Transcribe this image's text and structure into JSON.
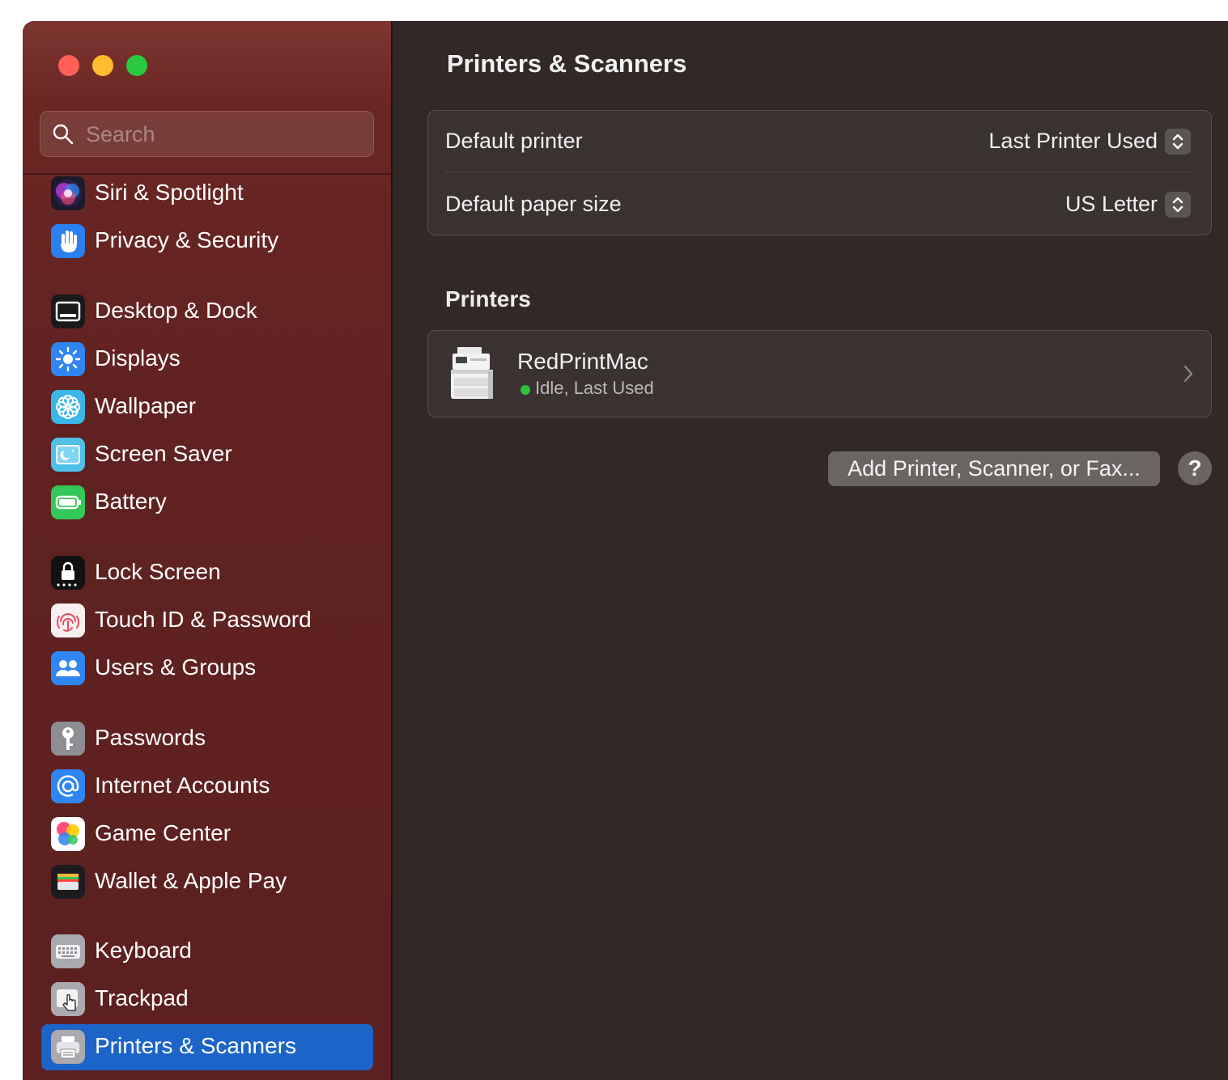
{
  "window": {
    "title": "Printers & Scanners"
  },
  "search": {
    "placeholder": "Search",
    "icon": "search-icon"
  },
  "sidebar": {
    "items": [
      {
        "label": "Siri & Spotlight",
        "icon": "siri-icon"
      },
      {
        "label": "Privacy & Security",
        "icon": "hand-icon"
      },
      {
        "label": "Desktop & Dock",
        "icon": "dock-icon"
      },
      {
        "label": "Displays",
        "icon": "sun-icon"
      },
      {
        "label": "Wallpaper",
        "icon": "flower-icon"
      },
      {
        "label": "Screen Saver",
        "icon": "screen-saver-icon"
      },
      {
        "label": "Battery",
        "icon": "battery-icon"
      },
      {
        "label": "Lock Screen",
        "icon": "lock-icon"
      },
      {
        "label": "Touch ID & Password",
        "icon": "fingerprint-icon"
      },
      {
        "label": "Users & Groups",
        "icon": "users-icon"
      },
      {
        "label": "Passwords",
        "icon": "key-icon"
      },
      {
        "label": "Internet Accounts",
        "icon": "at-icon"
      },
      {
        "label": "Game Center",
        "icon": "game-center-icon"
      },
      {
        "label": "Wallet & Apple Pay",
        "icon": "wallet-icon"
      },
      {
        "label": "Keyboard",
        "icon": "keyboard-icon"
      },
      {
        "label": "Trackpad",
        "icon": "trackpad-icon"
      },
      {
        "label": "Printers & Scanners",
        "icon": "printer-icon",
        "selected": true
      }
    ]
  },
  "defaults": {
    "printer_label": "Default printer",
    "printer_value": "Last Printer Used",
    "paper_label": "Default paper size",
    "paper_value": "US Letter"
  },
  "printers": {
    "section_title": "Printers",
    "list": [
      {
        "name": "RedPrintMac",
        "status": "Idle, Last Used",
        "status_color": "#29c23f"
      }
    ]
  },
  "actions": {
    "add_label": "Add Printer, Scanner, or Fax...",
    "help_label": "?"
  },
  "colors": {
    "selection": "#1d64c8",
    "sidebar": "#5f2221",
    "content": "#322927"
  }
}
